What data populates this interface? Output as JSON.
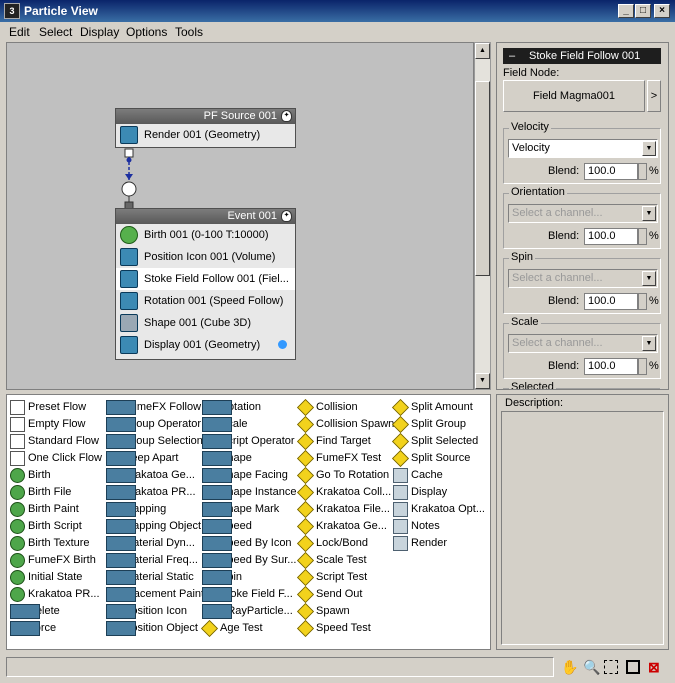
{
  "window": {
    "title": "Particle View"
  },
  "menu": [
    "Edit",
    "Select",
    "Display",
    "Options",
    "Tools"
  ],
  "nodes": {
    "source": {
      "title": "PF Source 001",
      "operators": [
        "Render 001 (Geometry)"
      ]
    },
    "event": {
      "title": "Event 001",
      "operators": [
        "Birth 001 (0-100 T:10000)",
        "Position Icon 001 (Volume)",
        "Stoke Field Follow 001 (Fiel...",
        "Rotation 001 (Speed Follow)",
        "Shape 001 (Cube 3D)",
        "Display 001 (Geometry)"
      ]
    }
  },
  "params": {
    "rollout_title": "Stoke Field Follow 001",
    "field_node_label": "Field Node:",
    "field_button": "Field Magma001",
    "field_arrow": ">",
    "blend_label": "Blend:",
    "percent": "%",
    "groups": [
      {
        "label": "Velocity",
        "value": "Velocity",
        "blend": "100.0"
      },
      {
        "label": "Orientation",
        "value": "Select a channel...",
        "blend": "100.0"
      },
      {
        "label": "Spin",
        "value": "Select a channel...",
        "blend": "100.0"
      },
      {
        "label": "Scale",
        "value": "Select a channel...",
        "blend": "100.0"
      }
    ],
    "next_group": "Selected"
  },
  "depot": {
    "columns": [
      [
        "Preset Flow",
        "Empty Flow",
        "Standard Flow",
        "One Click Flow",
        "Birth",
        "Birth File",
        "Birth Paint",
        "Birth Script",
        "Birth Texture",
        "FumeFX Birth",
        "Initial State",
        "Krakatoa PR...",
        "Delete",
        "Force"
      ],
      [
        "FumeFX Follow",
        "Group Operator",
        "Group Selection",
        "Keep Apart",
        "Krakatoa Ge...",
        "Krakatoa PR...",
        "Mapping",
        "Mapping Object",
        "Material Dyn...",
        "Material Freq...",
        "Material Static",
        "Placement Paint",
        "Position Icon",
        "Position Object"
      ],
      [
        "Rotation",
        "Scale",
        "Script Operator",
        "Shape",
        "Shape Facing",
        "Shape Instance",
        "Shape Mark",
        "Speed",
        "Speed By Icon",
        "Speed By Sur...",
        "Spin",
        "Stoke Field F...",
        "VRayParticle...",
        "Age Test"
      ],
      [
        "Collision",
        "Collision Spawn",
        "Find Target",
        "FumeFX Test",
        "Go To Rotation",
        "Krakatoa Coll...",
        "Krakatoa File...",
        "Krakatoa Ge...",
        "Lock/Bond",
        "Scale Test",
        "Script Test",
        "Send Out",
        "Spawn",
        "Speed Test"
      ],
      [
        "Split Amount",
        "Split Group",
        "Split Selected",
        "Split Source",
        "Cache",
        "Display",
        "Krakatoa Opt...",
        "Notes",
        "Render"
      ]
    ],
    "col_kinds": [
      [
        "flow",
        "flow",
        "flow",
        "flow",
        "birth",
        "birth",
        "birth",
        "birth",
        "birth",
        "birth",
        "birth",
        "birth",
        "op",
        "op"
      ],
      [
        "op",
        "op",
        "op",
        "op",
        "op",
        "op",
        "op",
        "op",
        "op",
        "op",
        "op",
        "op",
        "op",
        "op"
      ],
      [
        "op",
        "op",
        "op",
        "op",
        "op",
        "op",
        "op",
        "op",
        "op",
        "op",
        "op",
        "op",
        "op",
        "test"
      ],
      [
        "test",
        "test",
        "test",
        "test",
        "test",
        "test",
        "test",
        "test",
        "test",
        "test",
        "test",
        "test",
        "test",
        "test"
      ],
      [
        "test",
        "test",
        "test",
        "test",
        "other",
        "other",
        "other",
        "other",
        "other"
      ]
    ]
  },
  "description": {
    "label": "Description:"
  },
  "toolbar": [
    "hand-icon",
    "zoom-icon",
    "zoom-region-icon",
    "zoom-extents-icon",
    "no-update-icon"
  ]
}
